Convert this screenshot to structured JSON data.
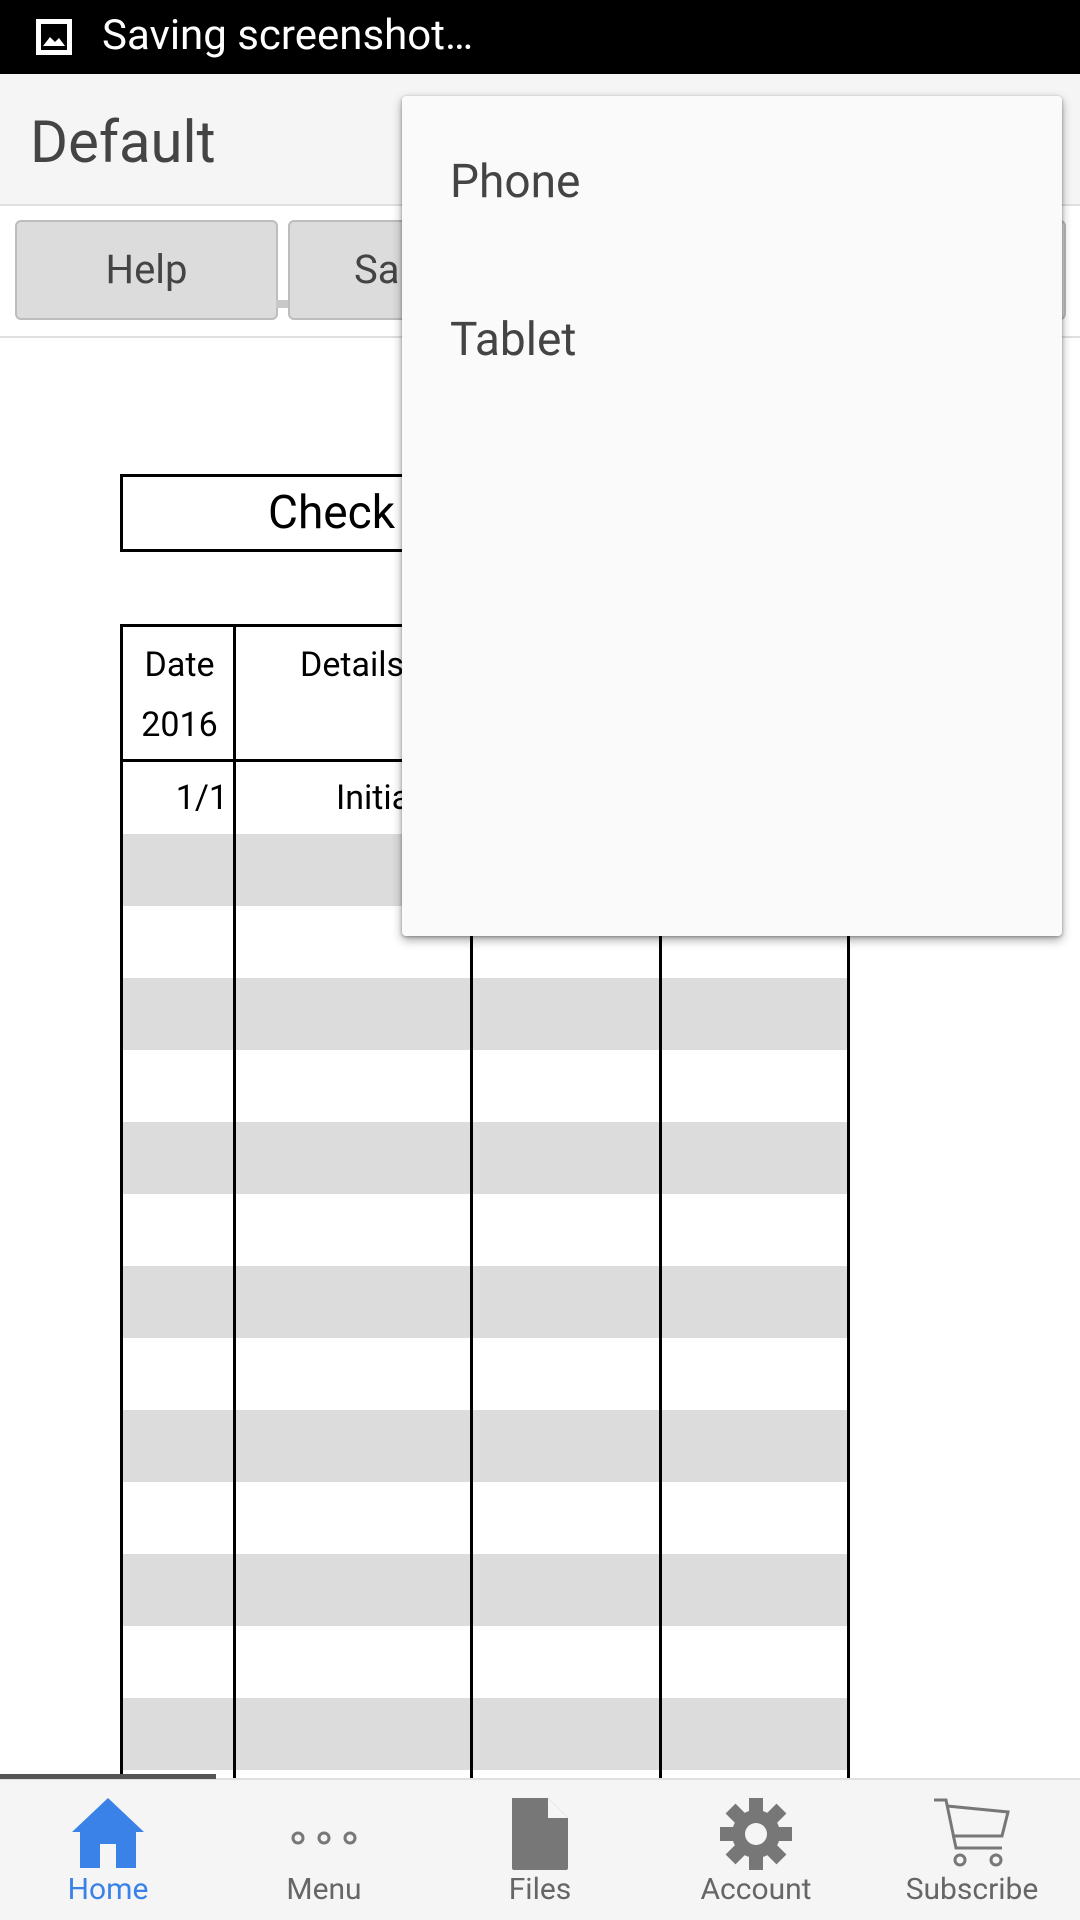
{
  "status_bar": {
    "text": "Saving screenshot…",
    "icon": "screenshot-icon"
  },
  "app_bar": {
    "title": "Default"
  },
  "toolbar": {
    "help_label": "Help",
    "save_label_partial": "Sa"
  },
  "sheet": {
    "title_partial": "Check",
    "headers": {
      "date_line1": "Date",
      "date_line2": "2016",
      "details_partial": "Details"
    },
    "first_row": {
      "date": "1/1",
      "details_partial": "Initia"
    }
  },
  "dropdown": {
    "items": [
      "Phone",
      "Tablet"
    ]
  },
  "bottom_nav": {
    "items": [
      {
        "label": "Home",
        "icon": "home-icon",
        "active": true
      },
      {
        "label": "Menu",
        "icon": "more-dots-icon",
        "active": false
      },
      {
        "label": "Files",
        "icon": "file-icon",
        "active": false
      },
      {
        "label": "Account",
        "icon": "gear-icon",
        "active": false
      },
      {
        "label": "Subscribe",
        "icon": "cart-icon",
        "active": false
      }
    ]
  },
  "colors": {
    "accent": "#3b82e8",
    "row_shade": "#dcdcdc",
    "status_bar": "#000000"
  }
}
